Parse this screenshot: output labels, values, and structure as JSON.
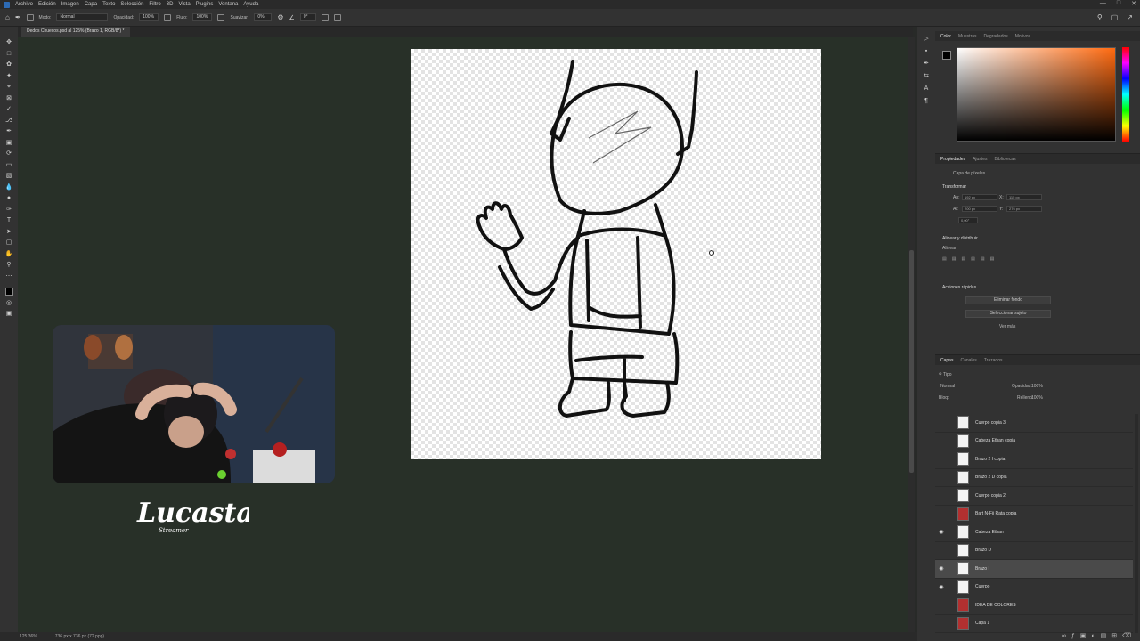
{
  "menubar": {
    "items": [
      "Archivo",
      "Edición",
      "Imagen",
      "Capa",
      "Texto",
      "Selección",
      "Filtro",
      "3D",
      "Vista",
      "Plugins",
      "Ventana",
      "Ayuda"
    ]
  },
  "options": {
    "mode_label": "Modo:",
    "mode_value": "Normal",
    "opacity_label": "Opacidad:",
    "opacity_value": "100%",
    "flow_label": "Flujo:",
    "flow_value": "100%",
    "smooth_label": "Suavizar:",
    "smooth_value": "0%",
    "angle_value": "0°"
  },
  "document": {
    "tab_title": "Dedos Chuecos.psd al 125% (Brazo 1, RGB/8*) *"
  },
  "statusbar": {
    "zoom": "125.36%",
    "size": "736 px x 736 px (72 ppp)"
  },
  "stream": {
    "logo_name": "Lucasta",
    "logo_sub": "Streamer"
  },
  "color_panel": {
    "tabs": [
      "Color",
      "Muestras",
      "Degradados",
      "Motivos"
    ],
    "foreground": "#000000",
    "hue_color": "#ff6a10"
  },
  "properties": {
    "tabs": [
      "Propiedades",
      "Ajustes",
      "Bibliotecas"
    ],
    "layer_type": "Capa de píxeles",
    "transform_label": "Transformar",
    "w_label": "An:",
    "w_value": "192 px",
    "h_label": "Al:",
    "h_value": "200 px",
    "x_label": "X:",
    "x_value": "115 px",
    "y_label": "Y:",
    "y_value": "276 px",
    "angle_value": "0,00°",
    "align_label": "Alinear y distribuir",
    "align_sub": "Alinear:",
    "quick_actions_label": "Acciones rápidas",
    "remove_bg": "Eliminar fondo",
    "select_subject": "Seleccionar sujeto",
    "more": "Ver más"
  },
  "layers_panel": {
    "tabs": [
      "Capas",
      "Canales",
      "Trazados"
    ],
    "kind_filter": "Tipo",
    "blend_mode": "Normal",
    "opacity_label": "Opacidad:",
    "opacity_value": "100%",
    "lock_label": "Bloq:",
    "fill_label": "Relleno:",
    "fill_value": "100%",
    "layers": [
      {
        "name": "Cuerpo copia 3",
        "visible": false,
        "thumb": "white"
      },
      {
        "name": "Cabeza Ethan copia",
        "visible": false,
        "thumb": "white"
      },
      {
        "name": "Brazo 2 I copia",
        "visible": false,
        "thumb": "white"
      },
      {
        "name": "Brazo 2 D copia",
        "visible": false,
        "thumb": "white"
      },
      {
        "name": "Cuerpo copia 2",
        "visible": false,
        "thumb": "white"
      },
      {
        "name": "Bart N-Fij Rata copia",
        "visible": false,
        "thumb": "red"
      },
      {
        "name": "Cabeza Ethan",
        "visible": true,
        "thumb": "white"
      },
      {
        "name": "Brazo D",
        "visible": false,
        "thumb": "white"
      },
      {
        "name": "Brazo I",
        "visible": true,
        "thumb": "white",
        "selected": true
      },
      {
        "name": "Cuerpo",
        "visible": true,
        "thumb": "white"
      },
      {
        "name": "IDEA DE COLORES",
        "visible": false,
        "thumb": "red"
      },
      {
        "name": "Capa 1",
        "visible": false,
        "thumb": "red"
      }
    ]
  }
}
